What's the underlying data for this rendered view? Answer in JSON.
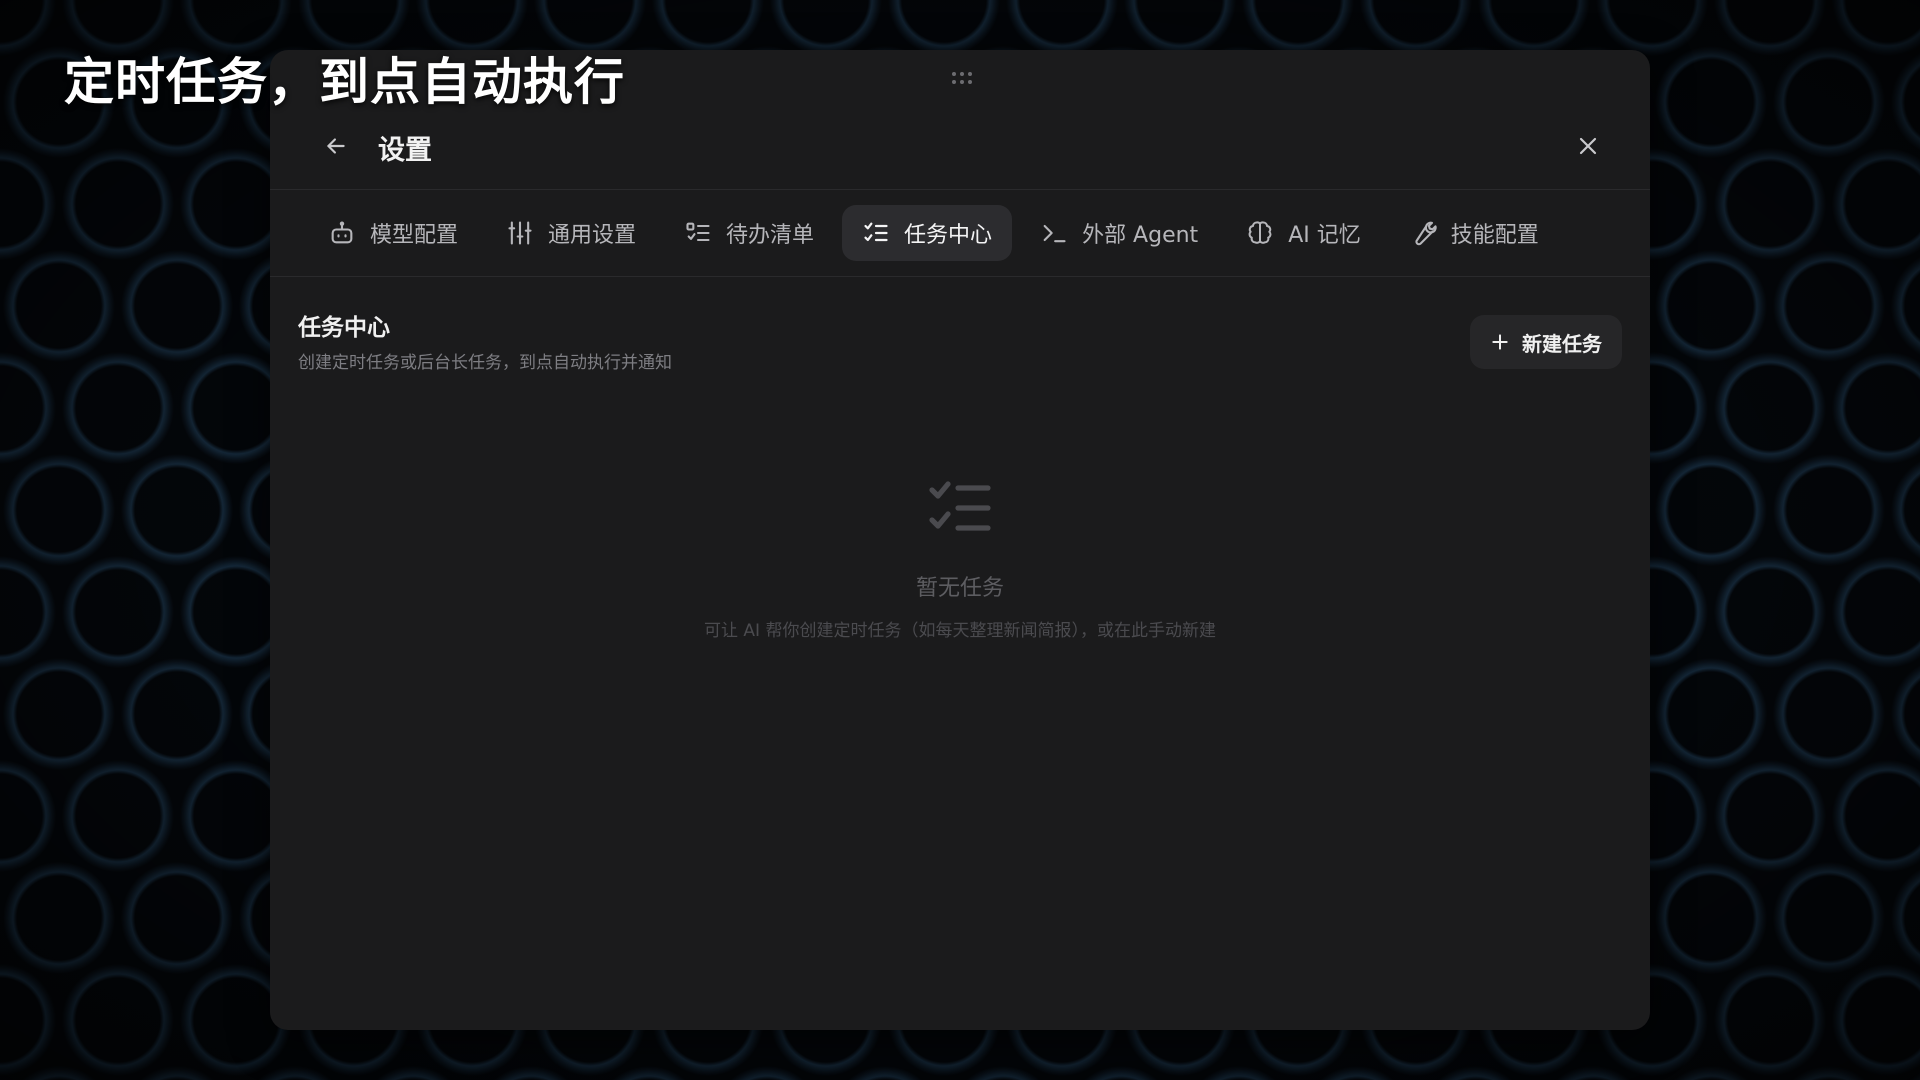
{
  "headline": "定时任务，到点自动执行",
  "dialog": {
    "title": "设置",
    "tabs": [
      {
        "label": "模型配置",
        "icon": "robot-icon",
        "active": false
      },
      {
        "label": "通用设置",
        "icon": "sliders-icon",
        "active": false
      },
      {
        "label": "待办清单",
        "icon": "list-icon",
        "active": false
      },
      {
        "label": "任务中心",
        "icon": "checklist-icon",
        "active": true
      },
      {
        "label": "外部 Agent",
        "icon": "terminal-icon",
        "active": false
      },
      {
        "label": "AI 记忆",
        "icon": "brain-icon",
        "active": false
      },
      {
        "label": "技能配置",
        "icon": "wrench-icon",
        "active": false
      }
    ],
    "section": {
      "title": "任务中心",
      "subtitle": "创建定时任务或后台长任务，到点自动执行并通知",
      "new_button": "新建任务"
    },
    "empty_state": {
      "icon": "checklist-icon",
      "title": "暂无任务",
      "description": "可让 AI 帮你创建定时任务（如每天整理新闻简报），或在此手动新建"
    }
  },
  "colors": {
    "dialog_bg": "#1b1b1c",
    "active_tab_bg": "#2c2c2f",
    "text_primary": "#f0f0f0",
    "text_secondary": "#7e7e83"
  }
}
